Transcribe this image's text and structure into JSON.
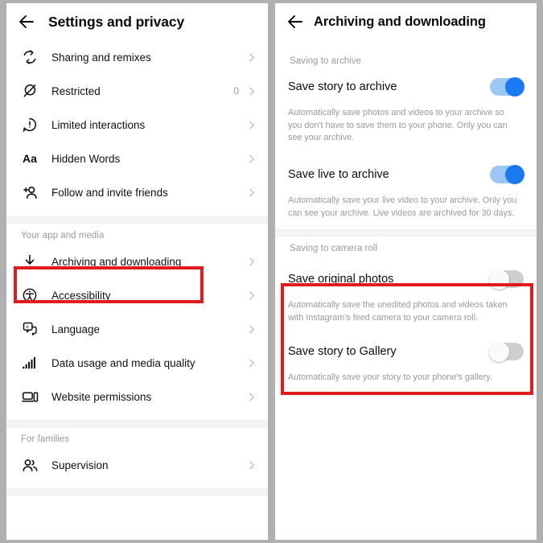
{
  "left_panel": {
    "back_icon": "back-arrow-icon",
    "title": "Settings and privacy",
    "items": [
      {
        "icon": "remix-arrows-icon",
        "label": "Sharing and remixes",
        "count": "",
        "chevron": "›"
      },
      {
        "icon": "restricted-circle-slash-icon",
        "label": "Restricted",
        "count": "0",
        "chevron": "›"
      },
      {
        "icon": "exclamation-bubble-icon",
        "label": "Limited interactions",
        "count": "",
        "chevron": "›"
      },
      {
        "icon": "hidden-words-aa-icon",
        "label": "Hidden Words",
        "count": "",
        "chevron": "›"
      },
      {
        "icon": "add-person-icon",
        "label": "Follow and invite friends",
        "count": "",
        "chevron": "›"
      }
    ],
    "section_app_media": "Your app and media",
    "app_media_items": [
      {
        "icon": "download-arrow-icon",
        "label": "Archiving and downloading",
        "count": "",
        "chevron": "›"
      },
      {
        "icon": "accessibility-icon",
        "label": "Accessibility",
        "count": "",
        "chevron": "›"
      },
      {
        "icon": "language-translate-icon",
        "label": "Language",
        "count": "",
        "chevron": "›"
      },
      {
        "icon": "signal-bars-icon",
        "label": "Data usage and media quality",
        "count": "",
        "chevron": "›"
      },
      {
        "icon": "website-permissions-icon",
        "label": "Website permissions",
        "count": "",
        "chevron": "›"
      }
    ],
    "section_families": "For families",
    "family_items": [
      {
        "icon": "supervision-people-icon",
        "label": "Supervision",
        "count": "",
        "chevron": "›"
      }
    ]
  },
  "right_panel": {
    "back_icon": "back-arrow-icon",
    "title": "Archiving and downloading",
    "section_archive": "Saving to archive",
    "save_story_archive": {
      "label": "Save story to archive",
      "toggle_state": "on",
      "description": "Automatically save photos and videos to your archive so you don't have to save them to your phone. Only you can see your archive."
    },
    "save_live_archive": {
      "label": "Save live to archive",
      "toggle_state": "on",
      "description": "Automatically save your live video to your archive. Only you can see your archive. Live videos are archived for 30 days."
    },
    "section_camera_roll": "Saving to camera roll",
    "save_original_photos": {
      "label": "Save original photos",
      "toggle_state": "off",
      "description": "Automatically save the unedited photos and videos taken with Instagram's feed camera to your camera roll."
    },
    "save_story_gallery": {
      "label": "Save story to Gallery",
      "toggle_state": "off",
      "description": "Automatically save your story to your phone's gallery."
    }
  },
  "annotations": {
    "highlight_color": "#e11b1b",
    "left_highlight_target": "Archiving and downloading",
    "right_highlight_target": "Saving to camera roll toggles"
  }
}
